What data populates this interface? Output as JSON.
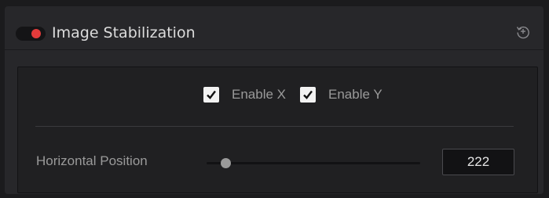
{
  "panel": {
    "title": "Image Stabilization",
    "enabled": true,
    "toggle_color": "#e23b3b",
    "reset_icon": "reset-icon"
  },
  "checkboxes": [
    {
      "label": "Enable X",
      "checked": true
    },
    {
      "label": "Enable Y",
      "checked": true
    }
  ],
  "slider": {
    "label": "Horizontal Position",
    "value": "222",
    "fraction": 0.09
  }
}
